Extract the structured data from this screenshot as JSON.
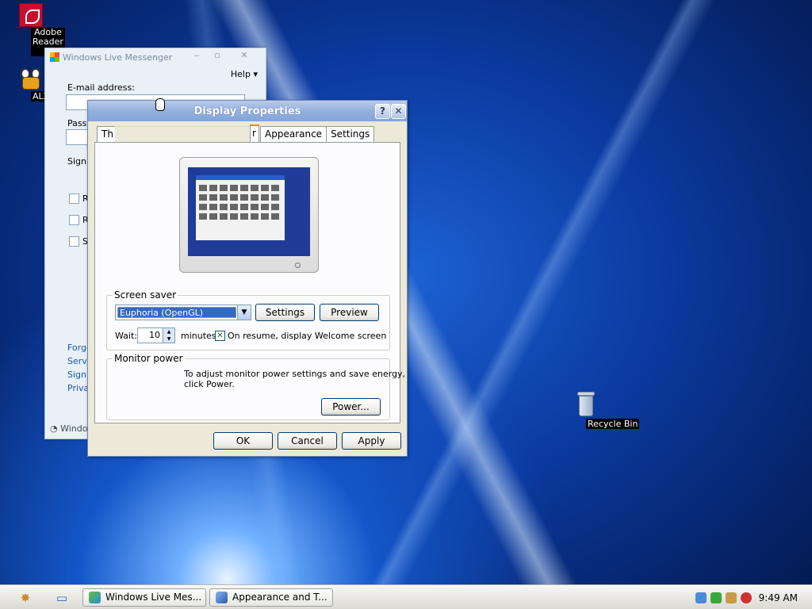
{
  "desktop": {
    "icons": [
      {
        "label": "Adobe Reader 8"
      },
      {
        "label": "ALZip"
      },
      {
        "label": "Recycle Bin"
      }
    ]
  },
  "messenger": {
    "title": "Windows Live Messenger",
    "help": "Help",
    "email_label": "E-mail address:",
    "password_label": "Passw",
    "sign_in_label": "Sign i",
    "check1": "R",
    "check2": "R",
    "check3": "S",
    "links": [
      "Forgo",
      "Servi",
      "Sign",
      "Priva"
    ],
    "footer": "Window"
  },
  "dialog": {
    "title": "Display Properties",
    "tabs": [
      "Th",
      "r",
      "Appearance",
      "Settings"
    ],
    "screensaver": {
      "group_label": "Screen saver",
      "selected": "Euphoria (OpenGL)",
      "settings_btn": "Settings",
      "preview_btn": "Preview",
      "wait_label": "Wait:",
      "wait_value": "10",
      "minutes_label": "minutes",
      "resume_label": "On resume, display Welcome screen"
    },
    "monitor_power": {
      "group_label": "Monitor power",
      "text1": "To adjust monitor power settings and save energy,",
      "text2": "click Power.",
      "power_btn": "Power..."
    },
    "ok": "OK",
    "cancel": "Cancel",
    "apply": "Apply"
  },
  "taskbar": {
    "tasks": [
      "Windows Live Mes...",
      "Appearance and T..."
    ],
    "clock": "9:49 AM"
  }
}
